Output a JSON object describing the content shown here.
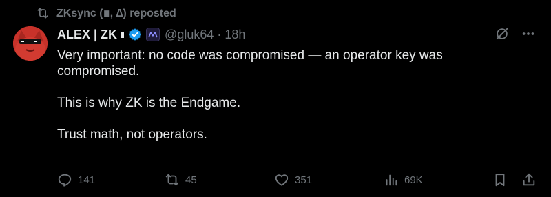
{
  "repost_banner": {
    "text": "ZKsync (∎, ∆) reposted",
    "icon": "repost-icon"
  },
  "author": {
    "display_name": "ALEX | ZK",
    "handle": "@gluk64",
    "separator": "·",
    "time": "18h",
    "verified": true,
    "avatar_icon": "red-cat-avatar",
    "affiliate_badge_icon": "zksync-affiliate-badge"
  },
  "tweet": {
    "paragraphs": [
      "Very important: no code was compromised — an operator key was compromised.",
      "This is why ZK is the Endgame.",
      "Trust math, not operators."
    ]
  },
  "actions": {
    "replies": "141",
    "reposts": "45",
    "likes": "351",
    "views": "69K"
  },
  "colors": {
    "background": "#000000",
    "text": "#e7e9ea",
    "muted": "#71767b",
    "verified": "#1d9bf0",
    "avatar": "#c8322a"
  }
}
